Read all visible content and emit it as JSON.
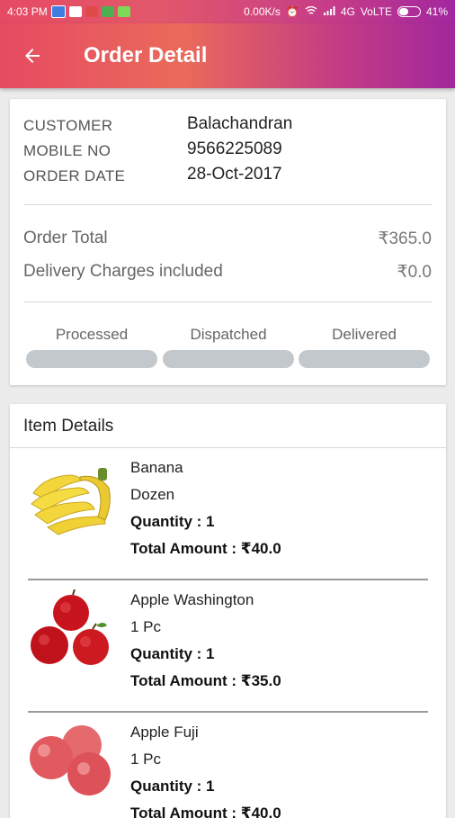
{
  "status_bar": {
    "time": "4:03 PM",
    "speed": "0.00K/s",
    "network": "4G",
    "carrier": "VoLTE",
    "battery": "41%"
  },
  "app_bar": {
    "title": "Order Detail"
  },
  "order": {
    "customer_label": "CUSTOMER",
    "customer_value": "Balachandran",
    "mobile_label": "MOBILE NO",
    "mobile_value": "9566225089",
    "date_label": "ORDER DATE",
    "date_value": "28-Oct-2017",
    "total_label": "Order Total",
    "total_value": "₹365.0",
    "delivery_label": "Delivery Charges included",
    "delivery_value": "₹0.0"
  },
  "steps": [
    {
      "label": "Processed",
      "done": false
    },
    {
      "label": "Dispatched",
      "done": false
    },
    {
      "label": "Delivered",
      "done": false
    }
  ],
  "items_section": {
    "title": "Item Details",
    "items": [
      {
        "name": "Banana",
        "unit": "Dozen",
        "quantity": "Quantity : 1",
        "total": "Total Amount : ₹40.0",
        "icon": "banana-image"
      },
      {
        "name": "Apple Washington",
        "unit": "1 Pc",
        "quantity": "Quantity : 1",
        "total": "Total Amount : ₹35.0",
        "icon": "apple-washington-image"
      },
      {
        "name": "Apple Fuji",
        "unit": "1 Pc",
        "quantity": "Quantity : 1",
        "total": "Total Amount : ₹40.0",
        "icon": "apple-fuji-image"
      }
    ]
  },
  "colors": {
    "header_gradient_start": "#e64a62",
    "header_gradient_end": "#a1289c",
    "step_bar": "#c3c8cc"
  }
}
